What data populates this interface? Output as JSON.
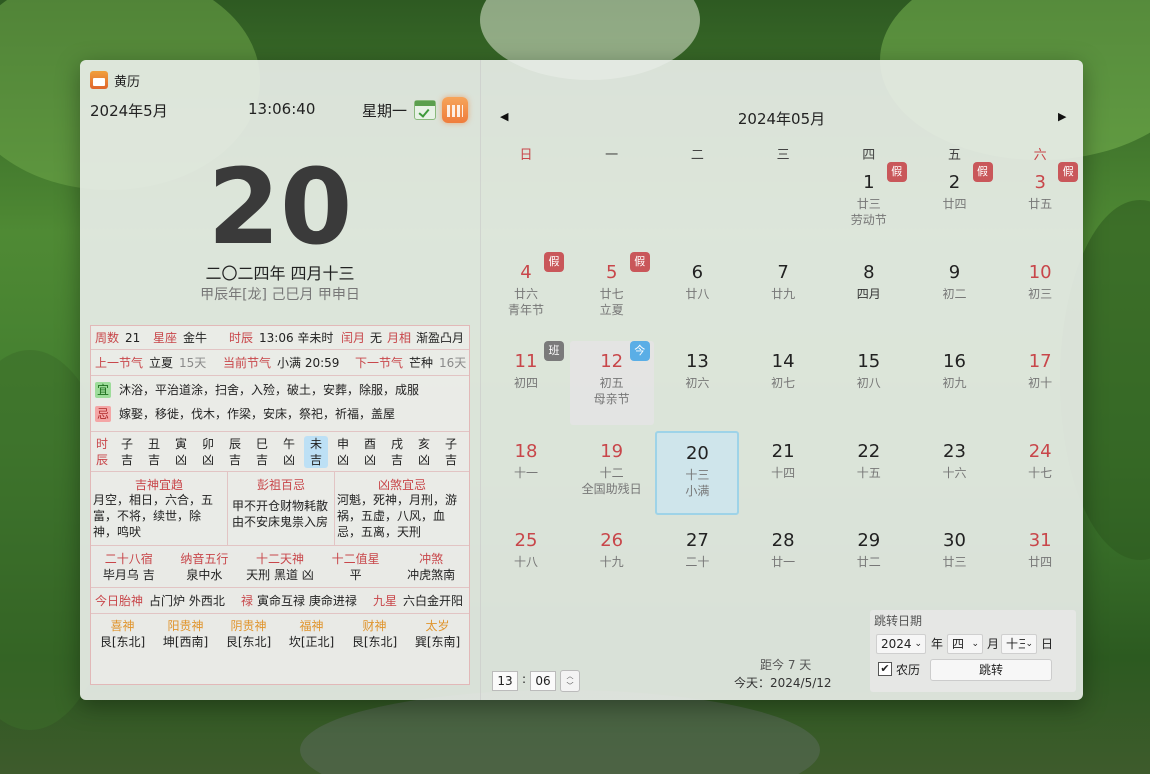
{
  "app": {
    "title": "黄历"
  },
  "header": {
    "month": "2024年5月",
    "time": "13:06:40",
    "weekday": "星期一"
  },
  "today": {
    "day": "20",
    "lunar": "二〇二四年 四月十三",
    "ganzhi": "甲辰年[龙] 己巳月 甲申日"
  },
  "info": {
    "row1": {
      "weeks_k": "周数",
      "weeks_v": "21",
      "star_k": "星座",
      "star_v": "金牛",
      "hour_k": "时辰",
      "hour_v": "13:06 辛未时",
      "leap_k": "闰月",
      "leap_v": "无",
      "moon_k": "月相",
      "moon_v": "渐盈凸月"
    },
    "row2": {
      "prev_k": "上一节气",
      "prev_v": "立夏",
      "prev_d": "15天",
      "cur_k": "当前节气",
      "cur_v": "小满 20:59",
      "next_k": "下一节气",
      "next_v": "芒种",
      "next_d": "16天"
    },
    "yi_label": "宜",
    "yi": "沐浴，平治道涂，扫舍，入殓，破土，安葬，除服，成服",
    "ji_label": "忌",
    "ji": "嫁娶，移徙，伐木，作梁，安床，祭祀，祈福，盖屋",
    "hours_label1": "时",
    "hours_label2": "辰",
    "hours": [
      {
        "b": "子",
        "f": "吉"
      },
      {
        "b": "丑",
        "f": "吉"
      },
      {
        "b": "寅",
        "f": "凶"
      },
      {
        "b": "卯",
        "f": "凶"
      },
      {
        "b": "辰",
        "f": "吉"
      },
      {
        "b": "巳",
        "f": "吉"
      },
      {
        "b": "午",
        "f": "凶"
      },
      {
        "b": "未",
        "f": "吉"
      },
      {
        "b": "申",
        "f": "凶"
      },
      {
        "b": "酉",
        "f": "凶"
      },
      {
        "b": "戌",
        "f": "吉"
      },
      {
        "b": "亥",
        "f": "凶"
      },
      {
        "b": "子",
        "f": "吉"
      }
    ],
    "good_title": "吉神宜趋",
    "good": "月空，相日，六合，五富，不将，续世，除神，鸣吠",
    "pengzu_title": "彭祖百忌",
    "pengzu": "甲不开仓财物耗散 由不安床鬼祟入房",
    "bad_title": "凶煞宜忌",
    "bad": "河魁，死神，月刑，游祸，五虚，八风，血忌，五离，天刑",
    "row6": [
      {
        "k": "二十八宿",
        "v": "毕月乌 吉"
      },
      {
        "k": "纳音五行",
        "v": "泉中水"
      },
      {
        "k": "十二天神",
        "v": "天刑 黑道 凶"
      },
      {
        "k": "十二值星",
        "v": "平"
      },
      {
        "k": "冲煞",
        "v": "冲虎煞南"
      }
    ],
    "row7": {
      "fetal_k": "今日胎神",
      "fetal_v": "占门炉 外西北",
      "lu_k": "禄",
      "lu_v": "寅命互禄 庚命进禄",
      "nine_k": "九星",
      "nine_v": "六白金开阳"
    },
    "gods": [
      {
        "k": "喜神",
        "v": "艮[东北]"
      },
      {
        "k": "阳贵神",
        "v": "坤[西南]"
      },
      {
        "k": "阴贵神",
        "v": "艮[东北]"
      },
      {
        "k": "福神",
        "v": "坎[正北]"
      },
      {
        "k": "财神",
        "v": "艮[东北]"
      },
      {
        "k": "太岁",
        "v": "巽[东南]"
      }
    ]
  },
  "calendar": {
    "title": "2024年05月",
    "weekdays": [
      "日",
      "一",
      "二",
      "三",
      "四",
      "五",
      "六"
    ],
    "holiday_badge": "假",
    "work_badge": "班",
    "today_badge": "今",
    "days": [
      {
        "d": "1",
        "l1": "廿三",
        "l2": "劳动节",
        "badge": "假"
      },
      {
        "d": "2",
        "l1": "廿四",
        "badge": "假"
      },
      {
        "d": "3",
        "l1": "廿五",
        "badge": "假"
      },
      {
        "d": "4",
        "l1": "廿六",
        "l2": "青年节",
        "badge": "假"
      },
      {
        "d": "5",
        "l1": "廿七",
        "l2": "立夏",
        "badge": "假"
      },
      {
        "d": "6",
        "l1": "廿八"
      },
      {
        "d": "7",
        "l1": "廿九"
      },
      {
        "d": "8",
        "l1": "四月"
      },
      {
        "d": "9",
        "l1": "初二"
      },
      {
        "d": "10",
        "l1": "初三"
      },
      {
        "d": "11",
        "l1": "初四",
        "badge": "班"
      },
      {
        "d": "12",
        "l1": "初五",
        "l2": "母亲节",
        "badge": "今"
      },
      {
        "d": "13",
        "l1": "初六"
      },
      {
        "d": "14",
        "l1": "初七"
      },
      {
        "d": "15",
        "l1": "初八"
      },
      {
        "d": "16",
        "l1": "初九"
      },
      {
        "d": "17",
        "l1": "初十"
      },
      {
        "d": "18",
        "l1": "十一"
      },
      {
        "d": "19",
        "l1": "十二",
        "l2": "全国助残日"
      },
      {
        "d": "20",
        "l1": "十三",
        "l2": "小满"
      },
      {
        "d": "21",
        "l1": "十四"
      },
      {
        "d": "22",
        "l1": "十五"
      },
      {
        "d": "23",
        "l1": "十六"
      },
      {
        "d": "24",
        "l1": "十七"
      },
      {
        "d": "25",
        "l1": "十八"
      },
      {
        "d": "26",
        "l1": "十九"
      },
      {
        "d": "27",
        "l1": "二十"
      },
      {
        "d": "28",
        "l1": "廿一"
      },
      {
        "d": "29",
        "l1": "廿二"
      },
      {
        "d": "30",
        "l1": "廿三"
      },
      {
        "d": "31",
        "l1": "廿四"
      }
    ],
    "first_weekday": 3
  },
  "footer": {
    "hour": "13",
    "minute": "06",
    "sep": ":",
    "distance": "距今 7 天",
    "today_text": "今天：2024/5/12"
  },
  "jump": {
    "title": "跳转日期",
    "year": "2024",
    "year_unit": "年",
    "month": "四",
    "month_unit": "月",
    "day": "十三",
    "day_unit": "日",
    "lunar_label": "农历",
    "lunar_checked": true,
    "button": "跳转"
  },
  "colors": {
    "holiday": "#c9575a",
    "work": "#7a7a7a",
    "today_badge": "#5aaee6",
    "selected": "#cfe3ea"
  }
}
